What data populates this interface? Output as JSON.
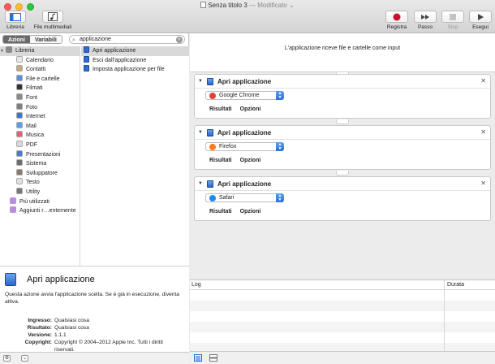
{
  "window": {
    "title": "Senza titolo 3",
    "status": "— Modificato",
    "status_arrow": "⌄"
  },
  "toolbar": {
    "left_buttons": [
      {
        "label": "Libreria",
        "icon": "sidebar-icon"
      },
      {
        "label": "File multimediali",
        "icon": "media-icon"
      }
    ],
    "right_buttons": [
      {
        "label": "Registra",
        "icon": "record-icon",
        "enabled": true
      },
      {
        "label": "Passo",
        "icon": "step-icon",
        "enabled": true
      },
      {
        "label": "Stop",
        "icon": "stop-icon",
        "enabled": false
      },
      {
        "label": "Esegui",
        "icon": "play-icon",
        "enabled": true
      }
    ]
  },
  "left_tabs": {
    "actions": "Azioni",
    "variables": "Variabili"
  },
  "search": {
    "value": "applicazione",
    "clear_glyph": "×"
  },
  "library": {
    "root": "Libreria",
    "items": [
      {
        "label": "Calendario",
        "color": "#e8e8e8"
      },
      {
        "label": "Contatti",
        "color": "#c9a878"
      },
      {
        "label": "File e cartelle",
        "color": "#5a8ede"
      },
      {
        "label": "Filmati",
        "color": "#333333"
      },
      {
        "label": "Font",
        "color": "#8a8a8a"
      },
      {
        "label": "Foto",
        "color": "#7f7f7f"
      },
      {
        "label": "Internet",
        "color": "#3a77c9"
      },
      {
        "label": "Mail",
        "color": "#5a9fe8"
      },
      {
        "label": "Musica",
        "color": "#f05a77"
      },
      {
        "label": "PDF",
        "color": "#d8d8d8"
      },
      {
        "label": "Presentazioni",
        "color": "#4b7bd0"
      },
      {
        "label": "Sistema",
        "color": "#6d6d6d"
      },
      {
        "label": "Sviluppatore",
        "color": "#8a7a6a"
      },
      {
        "label": "Testo",
        "color": "#e0e0e0"
      },
      {
        "label": "Utility",
        "color": "#777777"
      }
    ],
    "smart_groups": [
      {
        "label": "Più utilizzati",
        "color": "#b88ee0"
      },
      {
        "label": "Aggiunti r…entemente",
        "color": "#b88ee0"
      }
    ]
  },
  "actions": [
    {
      "label": "Apri applicazione",
      "selected": true
    },
    {
      "label": "Esci dall'applicazione",
      "selected": false
    },
    {
      "label": "Imposta applicazione per file",
      "selected": false
    }
  ],
  "description": {
    "title": "Apri applicazione",
    "text": "Questa azione avvia l'applicazione scelta. Se è già in esecuzione, diventa attiva.",
    "fields": [
      {
        "key": "Ingresso:",
        "value": "Qualsiasi cosa"
      },
      {
        "key": "Risultato:",
        "value": "Qualsiasi cosa"
      },
      {
        "key": "Versione:",
        "value": "1.1.1"
      },
      {
        "key": "Copyright:",
        "value": "Copyright © 2004–2012 Apple Inc. Tutti i diritti riservati."
      }
    ]
  },
  "workflow": {
    "header": "L'applicazione riceve file e cartelle come input",
    "cards": [
      {
        "title": "Apri applicazione",
        "app": "Google Chrome",
        "browser_color": "#db4437"
      },
      {
        "title": "Apri applicazione",
        "app": "Firefox",
        "browser_color": "#ff7a1a"
      },
      {
        "title": "Apri applicazione",
        "app": "Safari",
        "browser_color": "#1d8cf0"
      }
    ],
    "results_label": "Risultati",
    "options_label": "Opzioni"
  },
  "log": {
    "col_log": "Log",
    "col_duration": "Durata"
  }
}
